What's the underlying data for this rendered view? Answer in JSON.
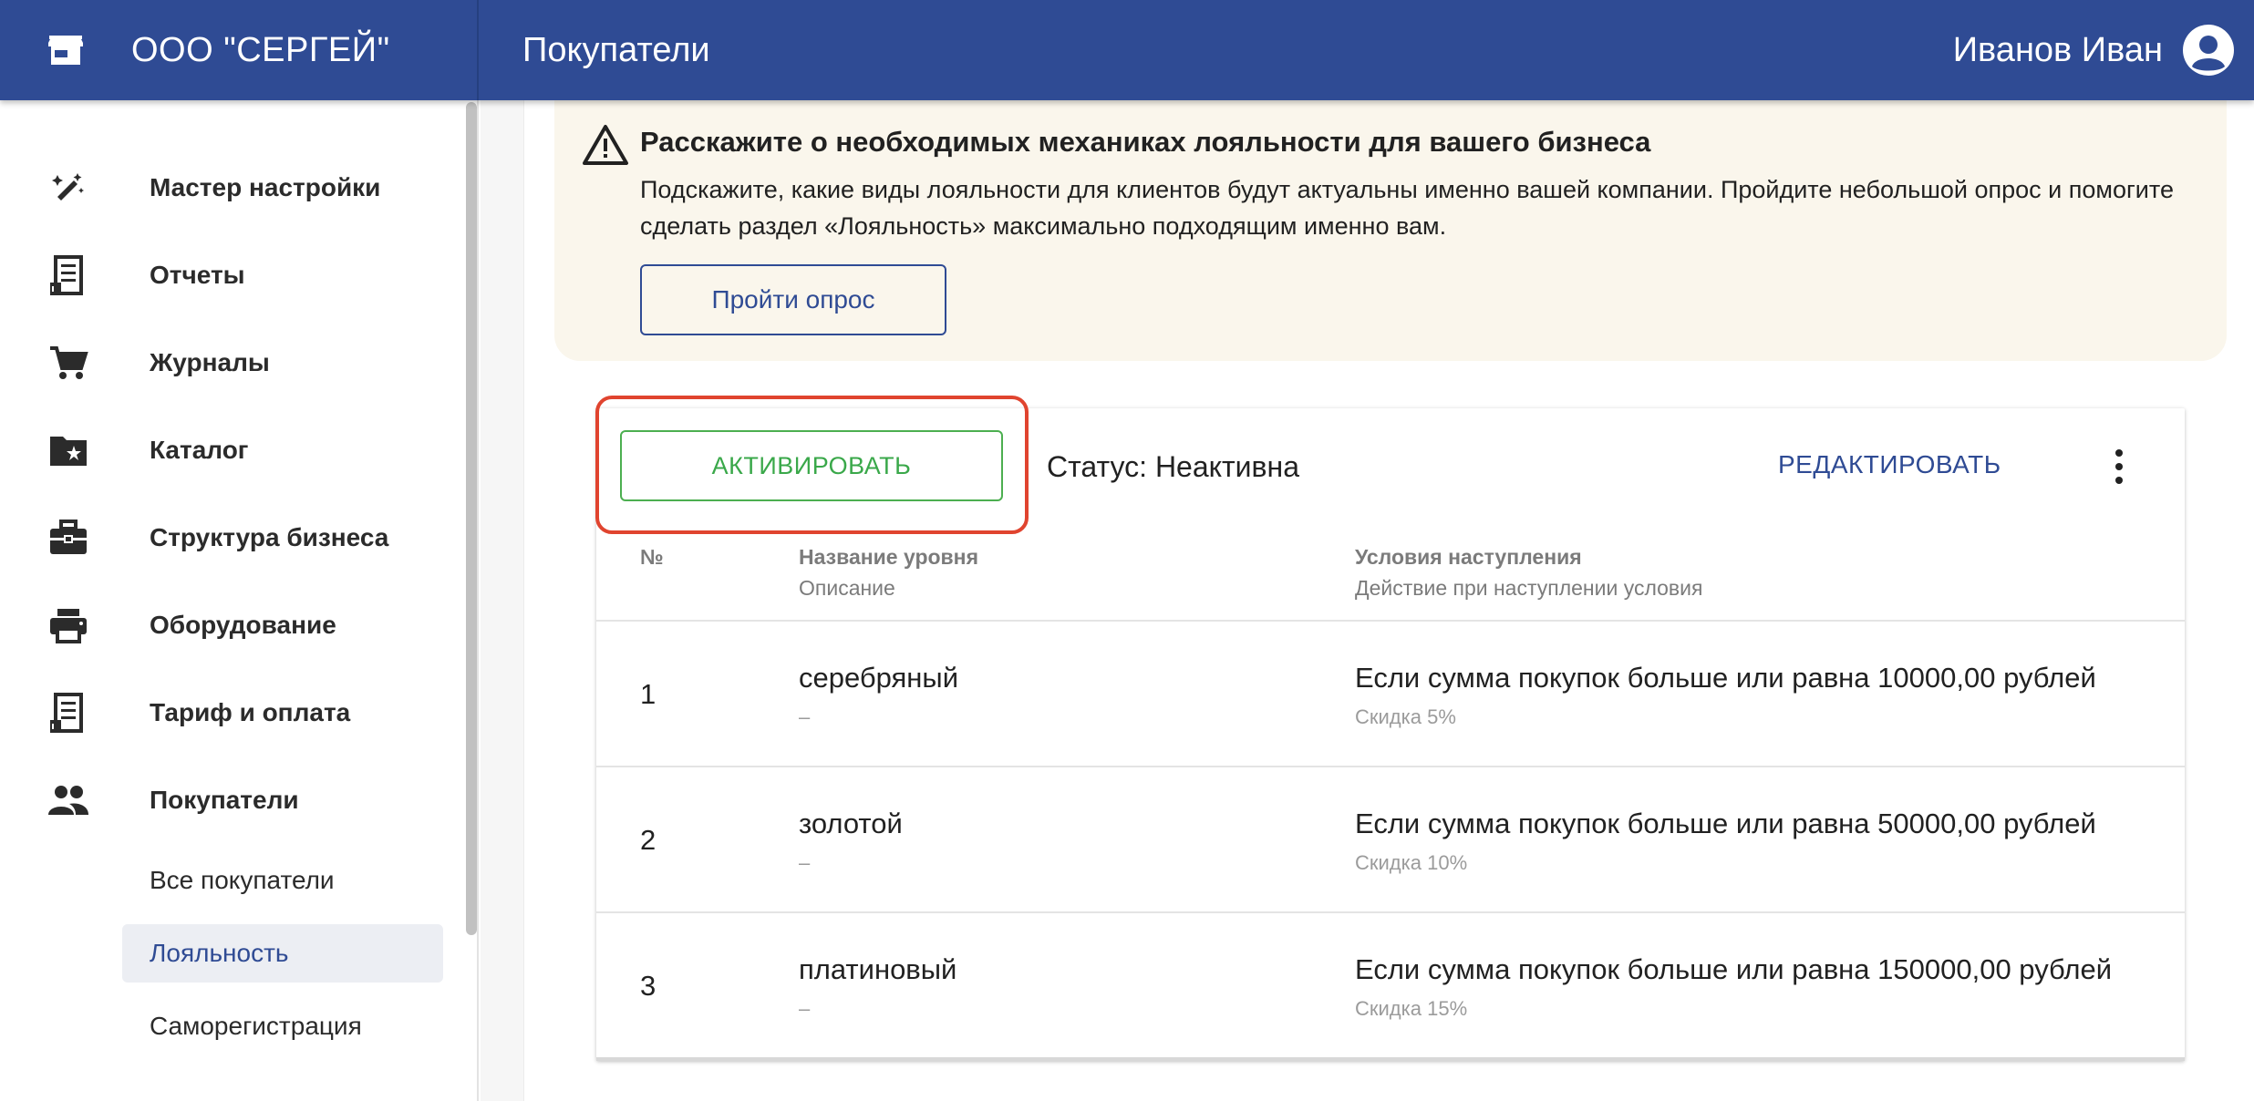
{
  "header": {
    "company": "ООО \"СЕРГЕЙ\"",
    "title": "Покупатели",
    "user_name": "Иванов Иван"
  },
  "sidebar": {
    "items": [
      {
        "label": "Мастер настройки",
        "icon": "magic-wand-icon"
      },
      {
        "label": "Отчеты",
        "icon": "receipt-icon"
      },
      {
        "label": "Журналы",
        "icon": "cart-icon"
      },
      {
        "label": "Каталог",
        "icon": "folder-star-icon"
      },
      {
        "label": "Структура бизнеса",
        "icon": "briefcase-icon"
      },
      {
        "label": "Оборудование",
        "icon": "printer-icon"
      },
      {
        "label": "Тариф и оплата",
        "icon": "receipt-icon"
      },
      {
        "label": "Покупатели",
        "icon": "people-icon"
      }
    ],
    "sub_items": [
      {
        "label": "Все покупатели",
        "active": false
      },
      {
        "label": "Лояльность",
        "active": true
      },
      {
        "label": "Саморегистрация",
        "active": false
      }
    ]
  },
  "banner": {
    "title": "Расскажите о необходимых механиках лояльности для вашего бизнеса",
    "text": "Подскажите, какие виды лояльности для клиентов будут актуальны именно вашей компании. Пройдите небольшой опрос и помогите сделать раздел «Лояльность» максимально подходящим именно вам.",
    "button": "Пройти опрос"
  },
  "loyalty": {
    "activate_label": "АКТИВИРОВАТЬ",
    "status": "Статус: Неактивна",
    "edit_label": "РЕДАКТИРОВАТЬ",
    "columns": {
      "num": "№",
      "name": "Название уровня",
      "desc": "Описание",
      "cond": "Условия наступления",
      "action": "Действие при наступлении условия"
    },
    "rows": [
      {
        "num": "1",
        "name": "серебряный",
        "desc": "–",
        "cond": "Если сумма покупок больше или равна 10000,00 рублей",
        "action": "Скидка 5%"
      },
      {
        "num": "2",
        "name": "золотой",
        "desc": "–",
        "cond": "Если сумма покупок больше или равна 50000,00 рублей",
        "action": "Скидка 10%"
      },
      {
        "num": "3",
        "name": "платиновый",
        "desc": "–",
        "cond": "Если сумма покупок больше или равна 150000,00 рублей",
        "action": "Скидка 15%"
      }
    ]
  },
  "colors": {
    "header": "#2f4b94",
    "accent": "#2f4b94",
    "activate": "#4caf50",
    "highlight": "#e0442f",
    "banner_bg": "#faf6ec"
  }
}
